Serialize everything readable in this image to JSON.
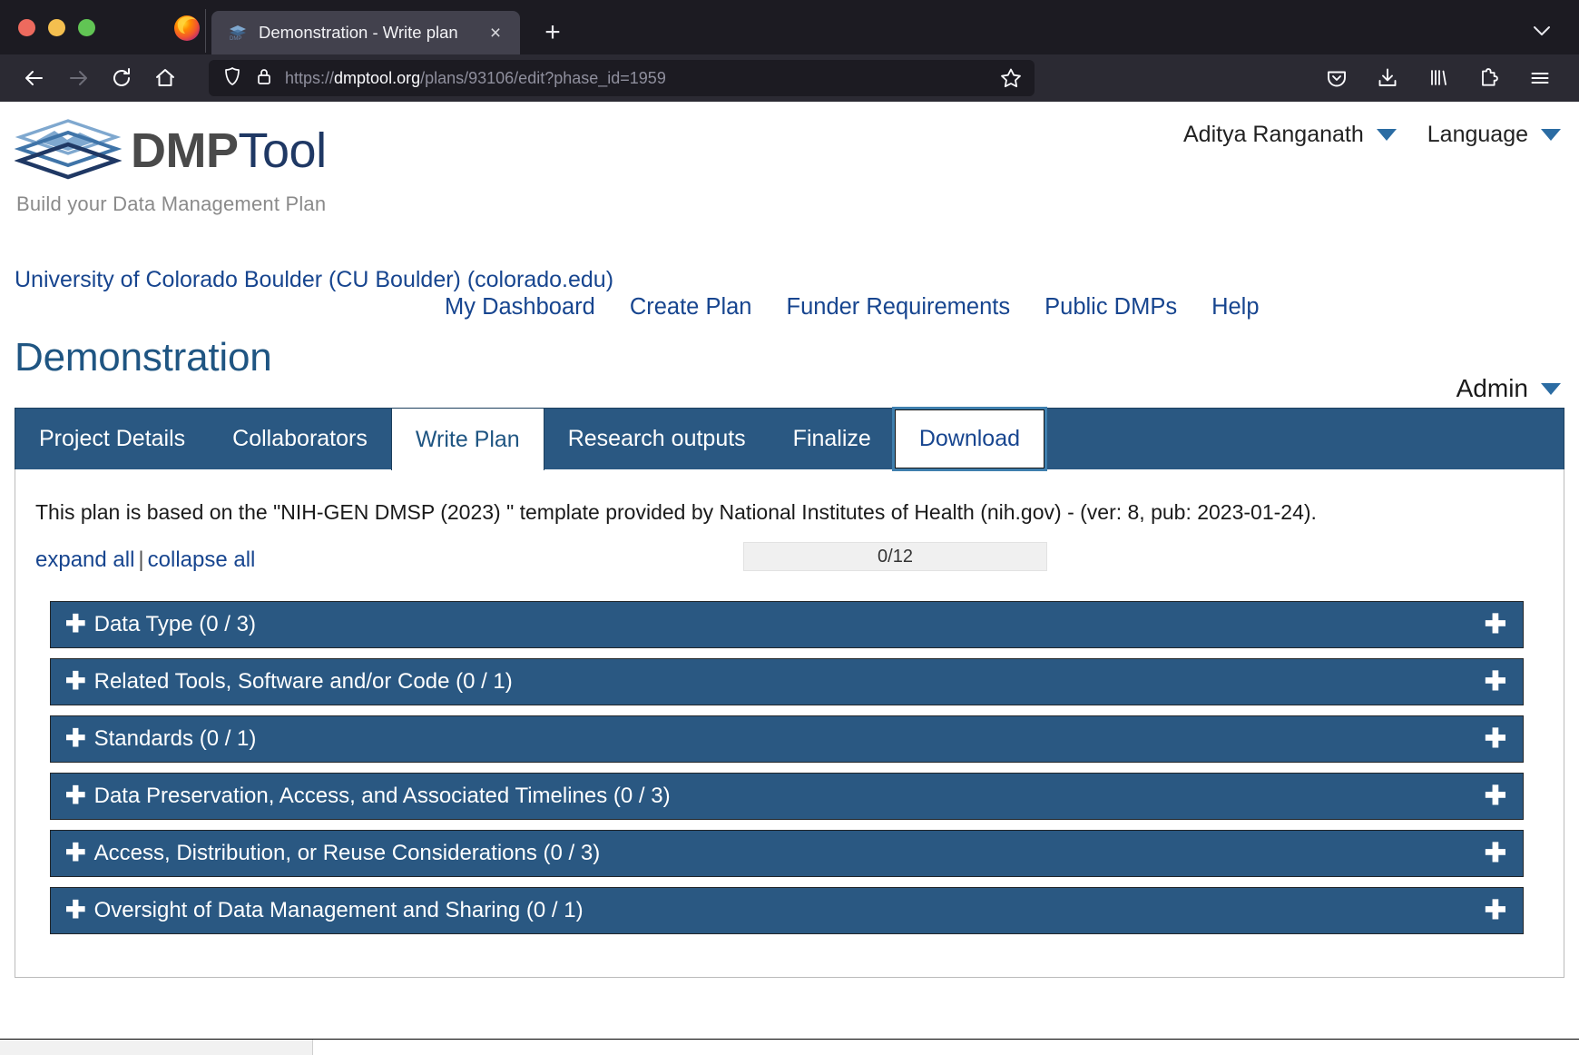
{
  "browser": {
    "tab": {
      "title": "Demonstration - Write plan",
      "favicon_name": "dmptool-favicon",
      "close_label": "×"
    },
    "new_tab_label": "+",
    "url": {
      "scheme": "https://",
      "host": "dmptool.org",
      "path": "/plans/93106/edit?phase_id=1959",
      "full": "https://dmptool.org/plans/93106/edit?phase_id=1959"
    },
    "icons": {
      "back": "back-arrow-icon",
      "forward": "forward-arrow-icon",
      "reload": "reload-icon",
      "home": "home-icon",
      "shield": "shield-icon",
      "lock": "padlock-icon",
      "bookmark": "star-icon",
      "pocket": "pocket-icon",
      "downloads": "download-icon",
      "library": "library-icon",
      "extensions": "puzzle-piece-icon",
      "menu": "hamburger-menu-icon",
      "tab_list": "chevron-down-icon"
    }
  },
  "site": {
    "brand_primary": "DMP",
    "brand_secondary": "Tool",
    "tagline": "Build your Data Management Plan",
    "user_menu": "Aditya Ranganath",
    "language_menu": "Language",
    "nav": [
      {
        "label": "My Dashboard"
      },
      {
        "label": "Create Plan"
      },
      {
        "label": "Funder Requirements"
      },
      {
        "label": "Public DMPs"
      },
      {
        "label": "Help"
      }
    ],
    "org_line": "University of Colorado Boulder (CU Boulder) (colorado.edu)",
    "admin_menu": "Admin"
  },
  "plan": {
    "title": "Demonstration",
    "tabs": [
      {
        "label": "Project Details",
        "state": "default"
      },
      {
        "label": "Collaborators",
        "state": "default"
      },
      {
        "label": "Write Plan",
        "state": "active"
      },
      {
        "label": "Research outputs",
        "state": "default"
      },
      {
        "label": "Finalize",
        "state": "default"
      },
      {
        "label": "Download",
        "state": "focused"
      }
    ],
    "description": "This plan is based on the \"NIH-GEN DMSP (2023) \" template provided by National Institutes of Health (nih.gov) - (ver: 8, pub: 2023-01-24).",
    "expand_all": "expand all",
    "collapse_all": "collapse all",
    "separator": "|",
    "progress": "0/12",
    "sections": [
      {
        "label": "Data Type (0 / 3)"
      },
      {
        "label": "Related Tools, Software and/or Code (0 / 1)"
      },
      {
        "label": "Standards (0 / 1)"
      },
      {
        "label": "Data Preservation, Access, and Associated Timelines (0 / 3)"
      },
      {
        "label": "Access, Distribution, or Reuse Considerations (0 / 3)"
      },
      {
        "label": "Oversight of Data Management and Sharing (0 / 1)"
      }
    ]
  },
  "colors": {
    "brand_blue": "#1f3864",
    "link_blue": "#17458f",
    "section_blue": "#2a5882",
    "title_blue": "#1f5582",
    "browser_chrome": "#2b2a33"
  }
}
